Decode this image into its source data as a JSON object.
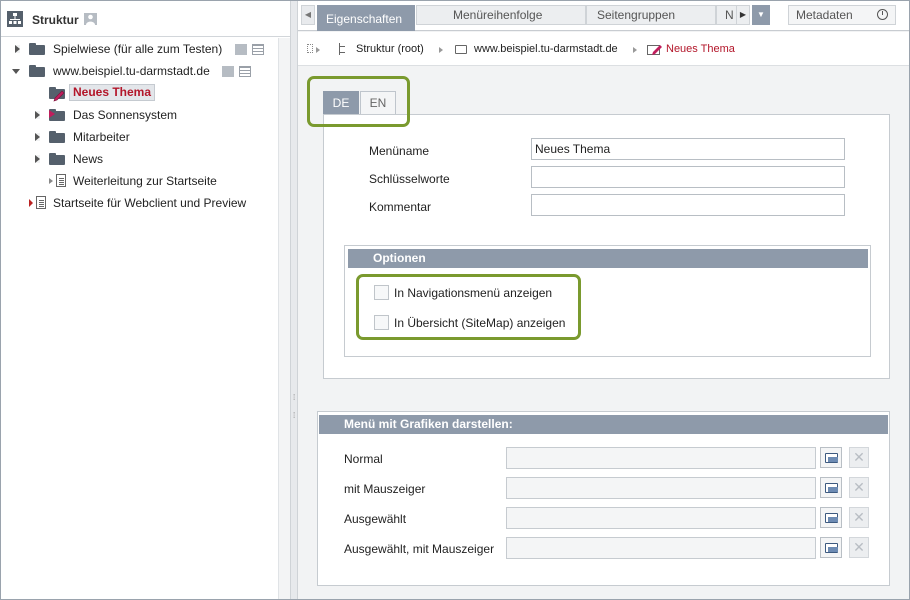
{
  "left_panel": {
    "title": "Struktur",
    "tree": [
      {
        "label": "Spielwiese (für alle zum Testen)"
      },
      {
        "label": "www.beispiel.tu-darmstadt.de"
      },
      {
        "label": "Neues Thema"
      },
      {
        "label": "Das Sonnensystem"
      },
      {
        "label": "Mitarbeiter"
      },
      {
        "label": "News"
      },
      {
        "label": "Weiterleitung zur Startseite"
      },
      {
        "label": "Startseite für Webclient und Preview"
      }
    ]
  },
  "tabs": {
    "items": [
      "Eigenschaften",
      "Menüreihenfolge",
      "Seitengruppen",
      "N"
    ],
    "metadata": "Metadaten"
  },
  "breadcrumb": {
    "items": [
      "Struktur (root)",
      "www.beispiel.tu-darmstadt.de",
      "Neues Thema"
    ]
  },
  "lang_tabs": [
    "DE",
    "EN"
  ],
  "form": {
    "menuname_label": "Menüname",
    "menuname_value": "Neues Thema",
    "keywords_label": "Schlüsselworte",
    "keywords_value": "",
    "comment_label": "Kommentar",
    "comment_value": ""
  },
  "options": {
    "title": "Optionen",
    "nav_menu": "In Navigationsmenü anzeigen",
    "sitemap": "In Übersicht (SiteMap) anzeigen"
  },
  "graphics": {
    "title": "Menü mit Grafiken darstellen:",
    "rows": [
      "Normal",
      "mit Mauszeiger",
      "Ausgewählt",
      "Ausgewählt, mit Mauszeiger"
    ]
  },
  "colors": {
    "accent": "#8e9aaa",
    "highlight": "#7a9a2e",
    "selected_text": "#b3162a"
  }
}
